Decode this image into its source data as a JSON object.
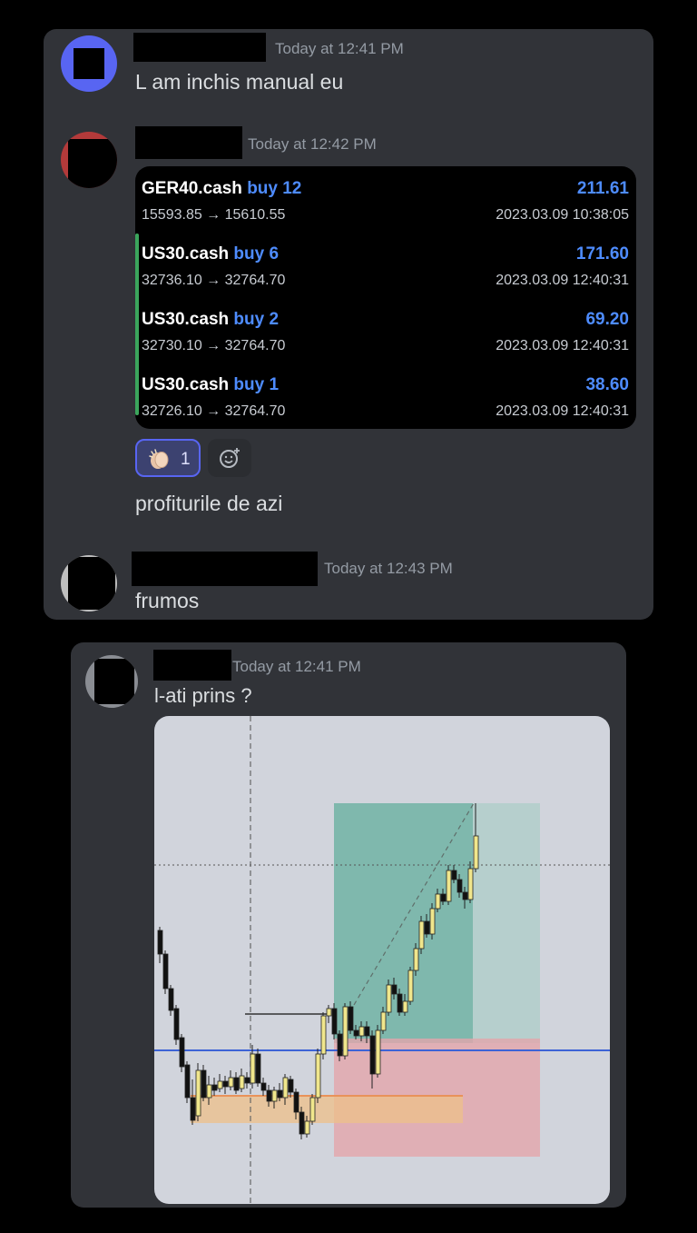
{
  "chat_top": {
    "messages": [
      {
        "timestamp": "Today at 12:41 PM",
        "text": "L am inchis manual eu"
      },
      {
        "timestamp": "Today at 12:42 PM",
        "text": "profiturile de azi"
      },
      {
        "timestamp": "Today at 12:43 PM",
        "text": "frumos"
      }
    ],
    "trades": [
      {
        "symbol": "GER40.cash",
        "side": "buy 12",
        "profit": "211.61",
        "prices": "15593.85 → 15610.55",
        "time": "2023.03.09 10:38:05"
      },
      {
        "symbol": "US30.cash",
        "side": "buy 6",
        "profit": "171.60",
        "prices": "32736.10 → 32764.70",
        "time": "2023.03.09 12:40:31"
      },
      {
        "symbol": "US30.cash",
        "side": "buy 2",
        "profit": "69.20",
        "prices": "32730.10 → 32764.70",
        "time": "2023.03.09 12:40:31"
      },
      {
        "symbol": "US30.cash",
        "side": "buy 1",
        "profit": "38.60",
        "prices": "32726.10 → 32764.70",
        "time": "2023.03.09 12:40:31"
      }
    ],
    "reaction": {
      "emoji": "clapping-hands",
      "count": "1"
    },
    "add_reaction_icon": "add-emoji-icon"
  },
  "chat_bottom": {
    "timestamp": "Today at 12:41 PM",
    "text": "l-ati prins ?"
  },
  "colors": {
    "card_bg": "#313338",
    "profit_blue": "#4e8cff",
    "accent_green": "#3ba55c",
    "candle_up": "#f0e68c",
    "candle_down": "#111111",
    "profit_zone": "#7fb8ad",
    "loss_zone": "#e3a5ab",
    "level_line": "#3d63d6"
  }
}
